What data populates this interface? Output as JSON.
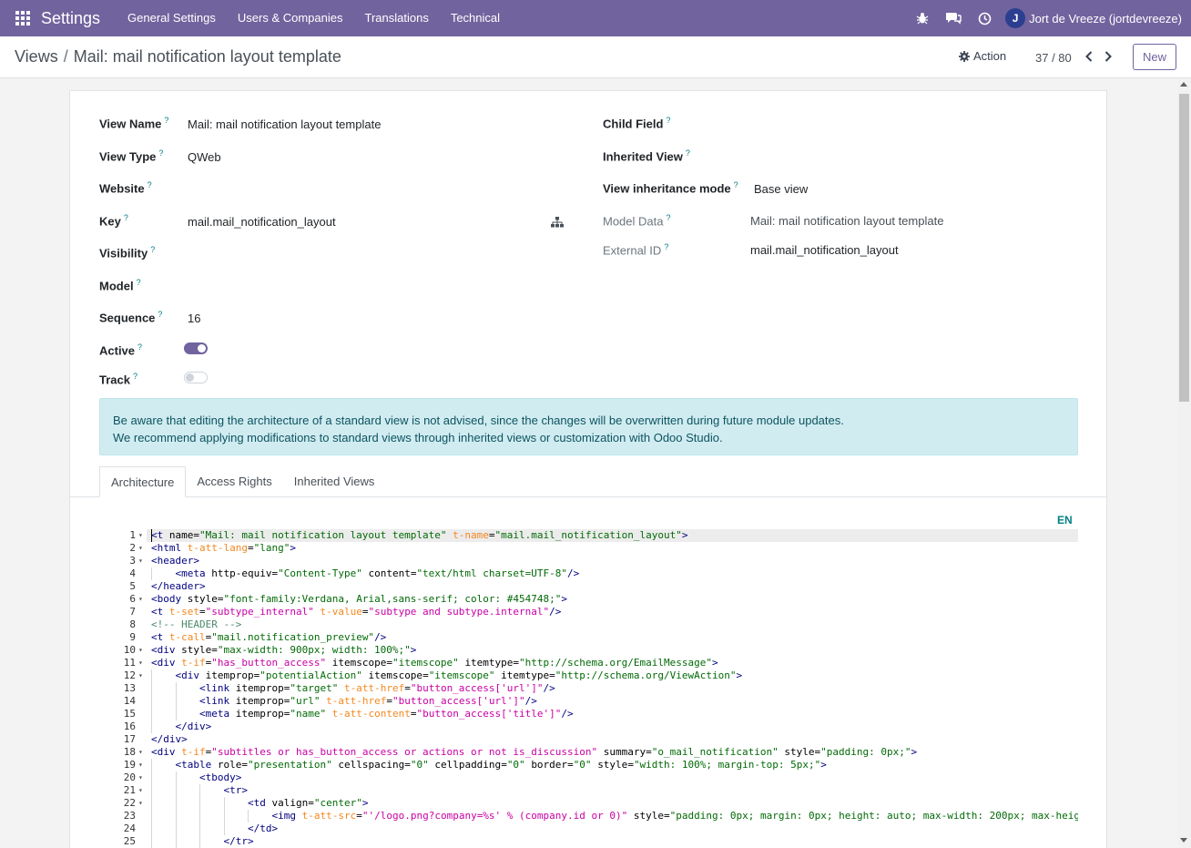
{
  "navbar": {
    "brand": "Settings",
    "menu": [
      "General Settings",
      "Users & Companies",
      "Translations",
      "Technical"
    ],
    "user_initial": "J",
    "user_name": "Jort de Vreeze (jortdevreeze)"
  },
  "control": {
    "breadcrumb_parent": "Views",
    "breadcrumb_sep": "/",
    "breadcrumb_current": "Mail: mail notification layout template",
    "action_label": "Action",
    "pager": "37 / 80",
    "new_label": "New"
  },
  "form": {
    "left": [
      {
        "label": "View Name",
        "value": "Mail: mail notification layout template"
      },
      {
        "label": "View Type",
        "value": "QWeb"
      },
      {
        "label": "Website",
        "value": ""
      },
      {
        "label": "Key",
        "value": "mail.mail_notification_layout"
      },
      {
        "label": "Visibility",
        "value": ""
      },
      {
        "label": "Model",
        "value": ""
      },
      {
        "label": "Sequence",
        "value": "16"
      },
      {
        "label": "Active",
        "value": "",
        "toggle": "on"
      },
      {
        "label": "Track",
        "value": "",
        "toggle": "off"
      }
    ],
    "right": [
      {
        "label": "Child Field",
        "value": ""
      },
      {
        "label": "Inherited View",
        "value": ""
      },
      {
        "label": "View inheritance mode",
        "value": "Base view"
      },
      {
        "label": "Model Data",
        "value": "Mail: mail notification layout template"
      },
      {
        "label": "External ID",
        "value": "mail.mail_notification_layout"
      }
    ],
    "qmark": "?"
  },
  "alert": {
    "line1": "Be aware that editing the architecture of a standard view is not advised, since the changes will be overwritten during future module updates.",
    "line2": "We recommend applying modifications to standard views through inherited views or customization with Odoo Studio."
  },
  "tabs": [
    "Architecture",
    "Access Rights",
    "Inherited Views"
  ],
  "editor": {
    "lang": "EN",
    "lines": [
      {
        "n": "1",
        "fold": true,
        "indent": 0,
        "html": "<span class=\"t\">&lt;t</span> <span class=\"a\">name</span>=<span class=\"s\">\"Mail: mail notification layout template\"</span> <span class=\"q\">t-name</span>=<span class=\"s\">\"mail.mail_notification_layout\"</span><span class=\"t\">&gt;</span>"
      },
      {
        "n": "2",
        "fold": true,
        "indent": 0,
        "html": "<span class=\"t\">&lt;html</span> <span class=\"q\">t-att-lang</span>=<span class=\"s\">\"lang\"</span><span class=\"t\">&gt;</span>"
      },
      {
        "n": "3",
        "fold": true,
        "indent": 0,
        "html": "<span class=\"t\">&lt;header&gt;</span>"
      },
      {
        "n": "4",
        "fold": false,
        "indent": 1,
        "html": "<span class=\"t\">&lt;meta</span> <span class=\"a\">http-equiv</span>=<span class=\"s\">\"Content-Type\"</span> <span class=\"a\">content</span>=<span class=\"s\">\"text/html charset=UTF-8\"</span><span class=\"t\">/&gt;</span>"
      },
      {
        "n": "5",
        "fold": false,
        "indent": 0,
        "html": "<span class=\"t\">&lt;/header&gt;</span>"
      },
      {
        "n": "6",
        "fold": true,
        "indent": 0,
        "html": "<span class=\"t\">&lt;body</span> <span class=\"a\">style</span>=<span class=\"s\">\"font-family:Verdana, Arial,sans-serif; color: #454748;\"</span><span class=\"t\">&gt;</span>"
      },
      {
        "n": "7",
        "fold": false,
        "indent": 0,
        "html": "<span class=\"t\">&lt;t</span> <span class=\"q\">t-set</span>=<span class=\"e\">\"subtype_internal\"</span> <span class=\"q\">t-value</span>=<span class=\"e\">\"subtype and subtype.internal\"</span><span class=\"t\">/&gt;</span>"
      },
      {
        "n": "8",
        "fold": false,
        "indent": 0,
        "html": "<span class=\"c\">&lt;!-- HEADER --&gt;</span>"
      },
      {
        "n": "9",
        "fold": false,
        "indent": 0,
        "html": "<span class=\"t\">&lt;t</span> <span class=\"q\">t-call</span>=<span class=\"s\">\"mail.notification_preview\"</span><span class=\"t\">/&gt;</span>"
      },
      {
        "n": "10",
        "fold": true,
        "indent": 0,
        "html": "<span class=\"t\">&lt;div</span> <span class=\"a\">style</span>=<span class=\"s\">\"max-width: 900px; width: 100%;\"</span><span class=\"t\">&gt;</span>"
      },
      {
        "n": "11",
        "fold": true,
        "indent": 0,
        "html": "<span class=\"t\">&lt;div</span> <span class=\"q\">t-if</span>=<span class=\"e\">\"has_button_access\"</span> <span class=\"a\">itemscope</span>=<span class=\"s\">\"itemscope\"</span> <span class=\"a\">itemtype</span>=<span class=\"s\">\"http://schema.org/EmailMessage\"</span><span class=\"t\">&gt;</span>"
      },
      {
        "n": "12",
        "fold": true,
        "indent": 1,
        "html": "<span class=\"t\">&lt;div</span> <span class=\"a\">itemprop</span>=<span class=\"s\">\"potentialAction\"</span> <span class=\"a\">itemscope</span>=<span class=\"s\">\"itemscope\"</span> <span class=\"a\">itemtype</span>=<span class=\"s\">\"http://schema.org/ViewAction\"</span><span class=\"t\">&gt;</span>"
      },
      {
        "n": "13",
        "fold": false,
        "indent": 2,
        "html": "<span class=\"t\">&lt;link</span> <span class=\"a\">itemprop</span>=<span class=\"s\">\"target\"</span> <span class=\"q\">t-att-href</span>=<span class=\"e\">\"button_access['url']\"</span><span class=\"t\">/&gt;</span>"
      },
      {
        "n": "14",
        "fold": false,
        "indent": 2,
        "html": "<span class=\"t\">&lt;link</span> <span class=\"a\">itemprop</span>=<span class=\"s\">\"url\"</span> <span class=\"q\">t-att-href</span>=<span class=\"e\">\"button_access['url']\"</span><span class=\"t\">/&gt;</span>"
      },
      {
        "n": "15",
        "fold": false,
        "indent": 2,
        "html": "<span class=\"t\">&lt;meta</span> <span class=\"a\">itemprop</span>=<span class=\"s\">\"name\"</span> <span class=\"q\">t-att-content</span>=<span class=\"e\">\"button_access['title']\"</span><span class=\"t\">/&gt;</span>"
      },
      {
        "n": "16",
        "fold": false,
        "indent": 1,
        "html": "<span class=\"t\">&lt;/div&gt;</span>"
      },
      {
        "n": "17",
        "fold": false,
        "indent": 0,
        "html": "<span class=\"t\">&lt;/div&gt;</span>"
      },
      {
        "n": "18",
        "fold": true,
        "indent": 0,
        "html": "<span class=\"t\">&lt;div</span> <span class=\"q\">t-if</span>=<span class=\"e\">\"subtitles or has_button_access or actions or not is_discussion\"</span> <span class=\"a\">summary</span>=<span class=\"s\">\"o_mail_notification\"</span> <span class=\"a\">style</span>=<span class=\"s\">\"padding: 0px;\"</span><span class=\"t\">&gt;</span>"
      },
      {
        "n": "19",
        "fold": true,
        "indent": 1,
        "html": "<span class=\"t\">&lt;table</span> <span class=\"a\">role</span>=<span class=\"s\">\"presentation\"</span> <span class=\"a\">cellspacing</span>=<span class=\"s\">\"0\"</span> <span class=\"a\">cellpadding</span>=<span class=\"s\">\"0\"</span> <span class=\"a\">border</span>=<span class=\"s\">\"0\"</span> <span class=\"a\">style</span>=<span class=\"s\">\"width: 100%; margin-top: 5px;\"</span><span class=\"t\">&gt;</span>"
      },
      {
        "n": "20",
        "fold": true,
        "indent": 2,
        "html": "<span class=\"t\">&lt;tbody&gt;</span>"
      },
      {
        "n": "21",
        "fold": true,
        "indent": 3,
        "html": "<span class=\"t\">&lt;tr&gt;</span>"
      },
      {
        "n": "22",
        "fold": true,
        "indent": 4,
        "html": "<span class=\"t\">&lt;td</span> <span class=\"a\">valign</span>=<span class=\"s\">\"center\"</span><span class=\"t\">&gt;</span>"
      },
      {
        "n": "23",
        "fold": false,
        "indent": 5,
        "html": "<span class=\"t\">&lt;img</span> <span class=\"q\">t-att-src</span>=<span class=\"e\">\"'/logo.png?company=%s' % (company.id or 0)\"</span> <span class=\"a\">style</span>=<span class=\"s\">\"padding: 0px; margin: 0px; height: auto; max-width: 200px; max-heig</span>"
      },
      {
        "n": "24",
        "fold": false,
        "indent": 4,
        "html": "<span class=\"t\">&lt;/td&gt;</span>"
      },
      {
        "n": "25",
        "fold": false,
        "indent": 3,
        "html": "<span class=\"t\">&lt;/tr&gt;</span>"
      }
    ]
  }
}
